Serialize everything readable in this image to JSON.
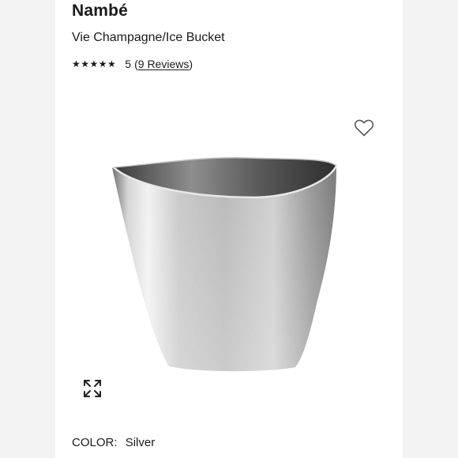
{
  "product": {
    "brand": "Nambé",
    "title": "Vie Champagne/Ice Bucket",
    "rating": {
      "stars": "★★★★★",
      "score": "5",
      "open_paren": "(",
      "reviews_link": "9 Reviews",
      "close_paren": ")"
    },
    "color": {
      "label": "COLOR:",
      "value": "Silver"
    }
  },
  "icons": {
    "wishlist": "heart-outline",
    "expand": "expand-arrows"
  },
  "colors": {
    "page_background": "#f3f3f3",
    "card_background": "#ffffff",
    "text": "#1a1a1a"
  }
}
